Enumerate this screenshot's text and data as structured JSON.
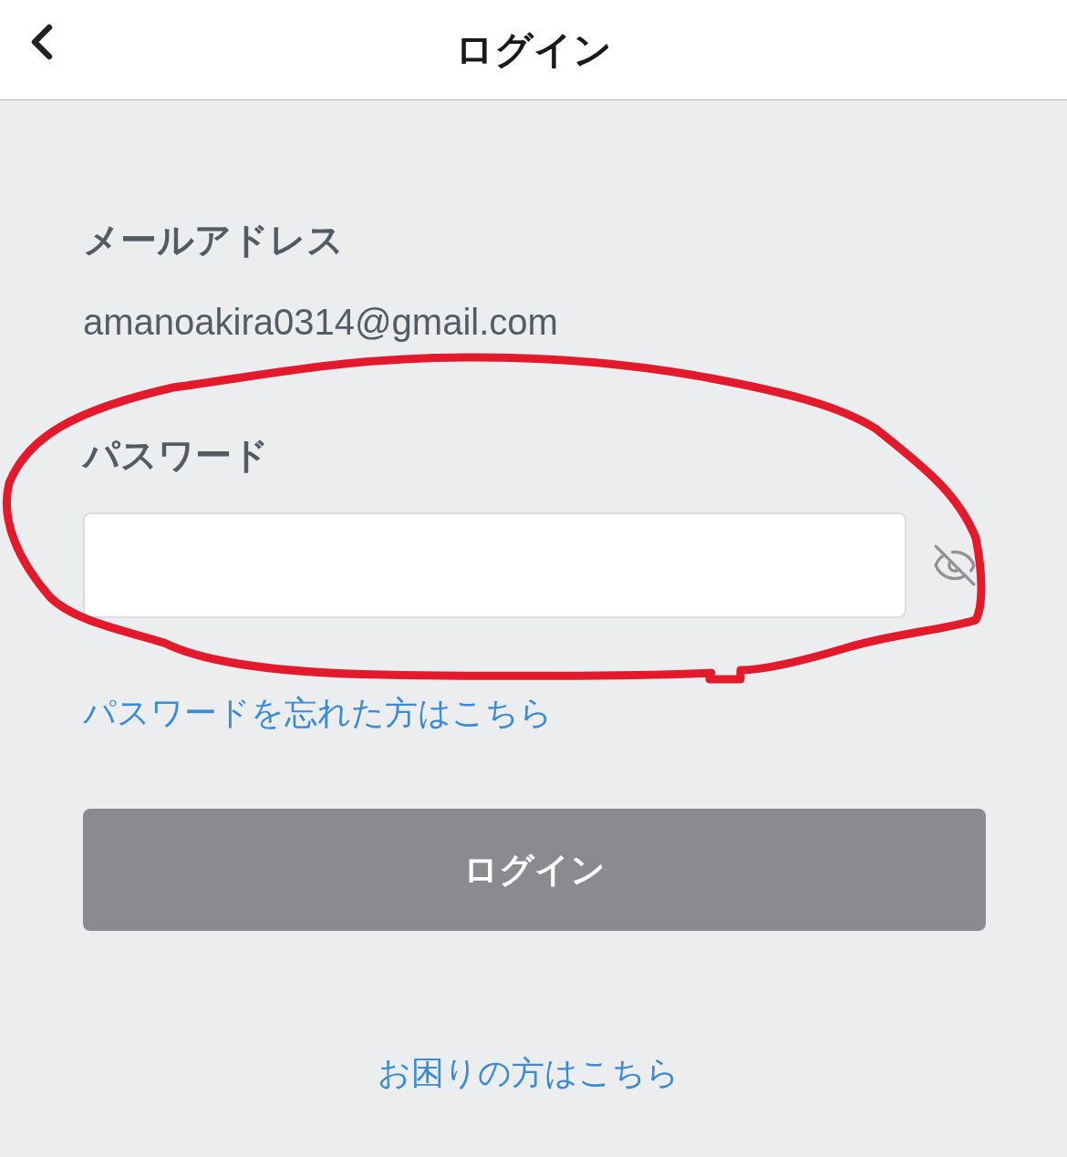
{
  "header": {
    "title": "ログイン"
  },
  "email": {
    "label": "メールアドレス",
    "value": "amanoakira0314@gmail.com"
  },
  "password": {
    "label": "パスワード",
    "visible": false
  },
  "forgot_link": "パスワードを忘れた方はこちら",
  "login_button": {
    "label": "ログイン",
    "disabled": true
  },
  "help_link": "お困りの方はこちら"
}
